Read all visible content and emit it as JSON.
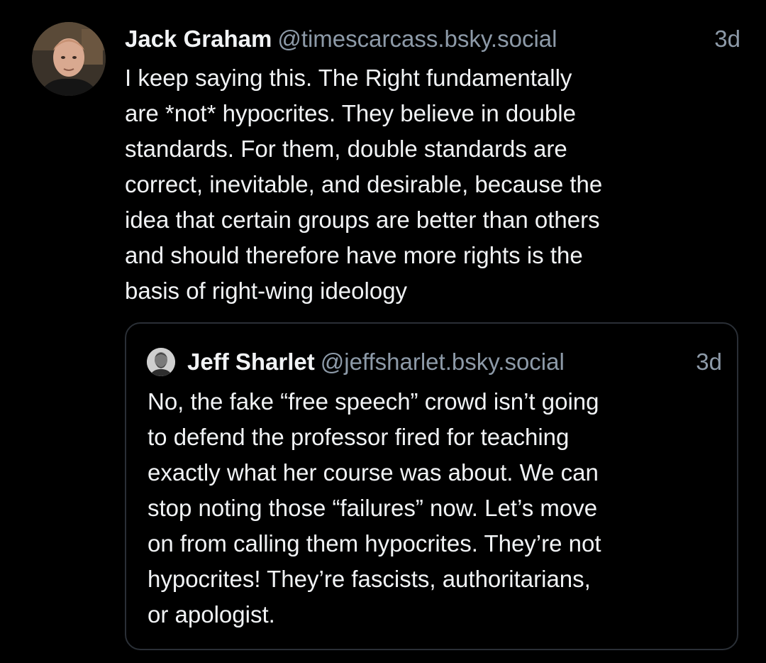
{
  "post": {
    "author_name": "Jack Graham",
    "author_handle": "@timescarcass.bsky.social",
    "time": "3d",
    "avatar_icon": "user-avatar",
    "text_lines": [
      "I keep saying this. The Right fundamentally",
      "are *not* hypocrites. They believe in double",
      "standards. For them, double standards are",
      "correct, inevitable, and desirable, because the",
      "idea that certain groups are better than others",
      "and should therefore have more rights is the",
      "basis of right-wing ideology"
    ]
  },
  "quote": {
    "author_name": "Jeff Sharlet",
    "author_handle": "@jeffsharlet.bsky.social",
    "time": "3d",
    "avatar_icon": "user-avatar",
    "text_lines": [
      "No, the fake “free speech” crowd isn’t going",
      "to defend the professor fired for teaching",
      "exactly what her course was about. We can",
      "stop noting those “failures” now. Let’s move",
      "on from calling them hypocrites. They’re not",
      "hypocrites! They’re fascists, authoritarians,",
      "or apologist."
    ]
  },
  "colors": {
    "background": "#000000",
    "primary_text": "#f1f3f5",
    "secondary_text": "#8d9aa8",
    "quote_border": "#2a2f36"
  }
}
